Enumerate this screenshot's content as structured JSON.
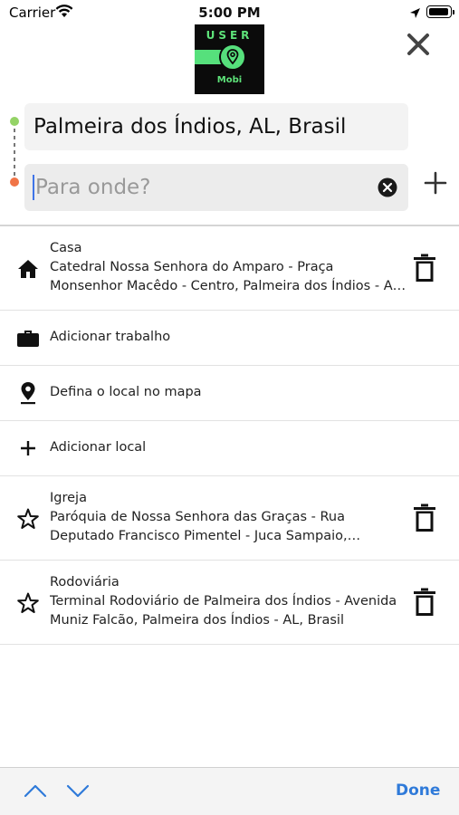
{
  "status_bar": {
    "carrier": "Carrier",
    "time": "5:00 PM"
  },
  "logo": {
    "word": "USER",
    "sub": "Mobi"
  },
  "route": {
    "origin": "Palmeira dos Índios, AL, Brasil",
    "destination_value": "",
    "destination_placeholder": "Para onde?"
  },
  "list": [
    {
      "type": "saved",
      "icon": "home-icon",
      "title": "Casa",
      "address": "Catedral Nossa Senhora do Amparo - Praça Monsenhor Macêdo - Centro, Palmeira dos Índios - AL, Brasil"
    },
    {
      "type": "action",
      "icon": "briefcase-icon",
      "label": "Adicionar trabalho"
    },
    {
      "type": "action",
      "icon": "map-pin-icon",
      "label": "Defina o local no mapa"
    },
    {
      "type": "action",
      "icon": "plus-icon",
      "label": "Adicionar local"
    },
    {
      "type": "saved",
      "icon": "star-icon",
      "title": "Igreja",
      "address": "Paróquia de Nossa Senhora das Graças - Rua Deputado Francisco Pimentel - Juca Sampaio, Palmeira dos Índios - AL, Brasil"
    },
    {
      "type": "saved",
      "icon": "star-icon",
      "title": "Rodoviária",
      "address": "Terminal Rodoviário de Palmeira dos Índios - Avenida Muniz Falcão, Palmeira dos Índios - AL, Brasil"
    }
  ],
  "toolbar": {
    "done_label": "Done"
  },
  "colors": {
    "origin_dot": "#94d366",
    "destination_dot": "#f07447",
    "logo_green": "#56e07c",
    "accent_blue": "#2f7ad9"
  }
}
